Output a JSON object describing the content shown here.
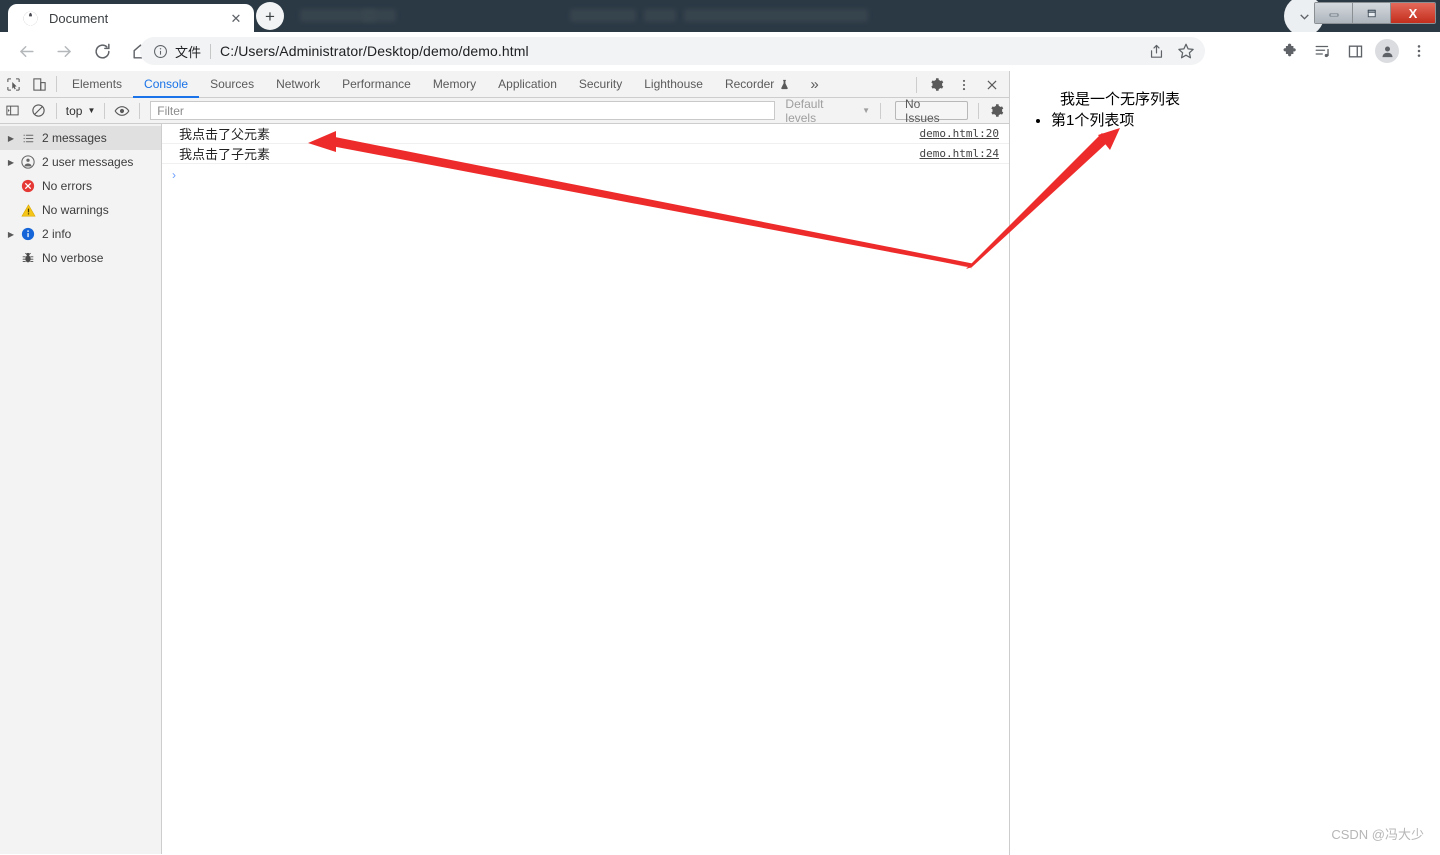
{
  "window": {
    "minimize_label": "—",
    "maximize_label": "❐",
    "close_label": "X",
    "caret_icon": "chevron-down-icon",
    "ghost_labels": [
      "Terminal",
      "Help",
      "demo.html",
      "demo",
      "Visual Studio Code [Administrator]"
    ]
  },
  "tabstrip": {
    "tab_title": "Document",
    "favicon": "globe-icon",
    "close_label": "✕",
    "newtab_label": "+"
  },
  "toolbar": {
    "back_icon": "arrow-left-icon",
    "forward_icon": "arrow-right-icon",
    "reload_icon": "reload-icon",
    "home_icon": "home-icon",
    "omnibox": {
      "info_icon": "info-circle-icon",
      "scheme_label": "文件",
      "url": "C:/Users/Administrator/Desktop/demo/demo.html",
      "share_icon": "share-icon",
      "bookmark_icon": "star-icon"
    },
    "extensions_icon": "puzzle-icon",
    "readinglist_icon": "reading-list-icon",
    "sidepanel_icon": "side-panel-icon",
    "profile_icon": "avatar-icon",
    "menu_icon": "three-dot-menu-icon"
  },
  "devtools": {
    "inspect_icon": "inspect-element-icon",
    "device_icon": "device-toolbar-icon",
    "tabs": [
      {
        "label": "Elements",
        "active": false
      },
      {
        "label": "Console",
        "active": true
      },
      {
        "label": "Sources",
        "active": false
      },
      {
        "label": "Network",
        "active": false
      },
      {
        "label": "Performance",
        "active": false
      },
      {
        "label": "Memory",
        "active": false
      },
      {
        "label": "Application",
        "active": false
      },
      {
        "label": "Security",
        "active": false
      },
      {
        "label": "Lighthouse",
        "active": false
      },
      {
        "label": "Recorder",
        "active": false
      }
    ],
    "recorder_badge_icon": "flask-icon",
    "more_tabs_label": "»",
    "settings_icon": "gear-icon",
    "kebab_icon": "three-dot-menu-icon",
    "close_icon": "close-icon",
    "filterbar": {
      "sidebar_toggle_icon": "sidebar-toggle-icon",
      "clear_console_icon": "clear-console-icon",
      "context_label": "top",
      "context_caret": "▼",
      "eye_icon": "eye-icon",
      "filter_placeholder": "Filter",
      "filter_value": "",
      "levels_label": "Default levels",
      "levels_caret": "▼",
      "issues_label": "No Issues",
      "settings_icon": "gear-icon"
    },
    "sidebar": [
      {
        "label": "2 messages",
        "icon": "list-icon",
        "expandable": true,
        "selected": true
      },
      {
        "label": "2 user messages",
        "icon": "user-icon",
        "expandable": true,
        "selected": false
      },
      {
        "label": "No errors",
        "icon": "error-icon",
        "expandable": false,
        "selected": false
      },
      {
        "label": "No warnings",
        "icon": "warning-icon",
        "expandable": false,
        "selected": false
      },
      {
        "label": "2 info",
        "icon": "info-icon",
        "expandable": true,
        "selected": false
      },
      {
        "label": "No verbose",
        "icon": "bug-icon",
        "expandable": false,
        "selected": false
      }
    ],
    "messages": [
      {
        "text": "我点击了父元素",
        "source": "demo.html:20"
      },
      {
        "text": "我点击了子元素",
        "source": "demo.html:24"
      }
    ],
    "prompt_caret": "›"
  },
  "page": {
    "heading": "我是一个无序列表",
    "list_items": [
      "第1个列表项"
    ]
  },
  "annotations": {
    "arrow_color": "#ee2b2b",
    "arrow_to_console_label": "arrow-pointing-to-console-messages",
    "arrow_to_list_label": "arrow-pointing-to-list-item"
  },
  "watermark": "CSDN @冯大少"
}
